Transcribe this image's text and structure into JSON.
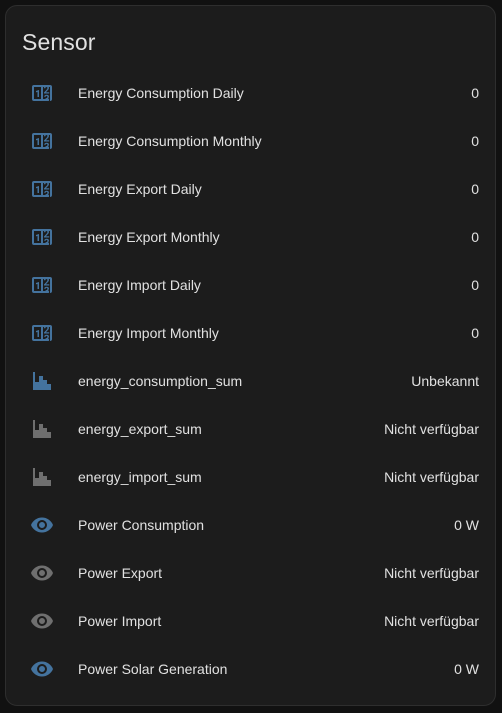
{
  "card": {
    "title": "Sensor"
  },
  "colors": {
    "active_icon": "#44739e",
    "inactive_icon": "#6f6f6f",
    "text": "#e1e1e1",
    "card_bg": "#1c1c1c"
  },
  "rows": [
    {
      "name": "Energy Consumption Daily",
      "state": "0",
      "icon": "counter-icon",
      "active": true
    },
    {
      "name": "Energy Consumption Monthly",
      "state": "0",
      "icon": "counter-icon",
      "active": true
    },
    {
      "name": "Energy Export Daily",
      "state": "0",
      "icon": "counter-icon",
      "active": true
    },
    {
      "name": "Energy Export Monthly",
      "state": "0",
      "icon": "counter-icon",
      "active": true
    },
    {
      "name": "Energy Import Daily",
      "state": "0",
      "icon": "counter-icon",
      "active": true
    },
    {
      "name": "Energy Import Monthly",
      "state": "0",
      "icon": "counter-icon",
      "active": true
    },
    {
      "name": "energy_consumption_sum",
      "state": "Unbekannt",
      "icon": "chart-histogram-icon",
      "active": true
    },
    {
      "name": "energy_export_sum",
      "state": "Nicht verfügbar",
      "icon": "chart-histogram-icon",
      "active": false
    },
    {
      "name": "energy_import_sum",
      "state": "Nicht verfügbar",
      "icon": "chart-histogram-icon",
      "active": false
    },
    {
      "name": "Power Consumption",
      "state": "0 W",
      "icon": "eye-icon",
      "active": true
    },
    {
      "name": "Power Export",
      "state": "Nicht verfügbar",
      "icon": "eye-icon",
      "active": false
    },
    {
      "name": "Power Import",
      "state": "Nicht verfügbar",
      "icon": "eye-icon",
      "active": false
    },
    {
      "name": "Power Solar Generation",
      "state": "0 W",
      "icon": "eye-icon",
      "active": true
    }
  ]
}
